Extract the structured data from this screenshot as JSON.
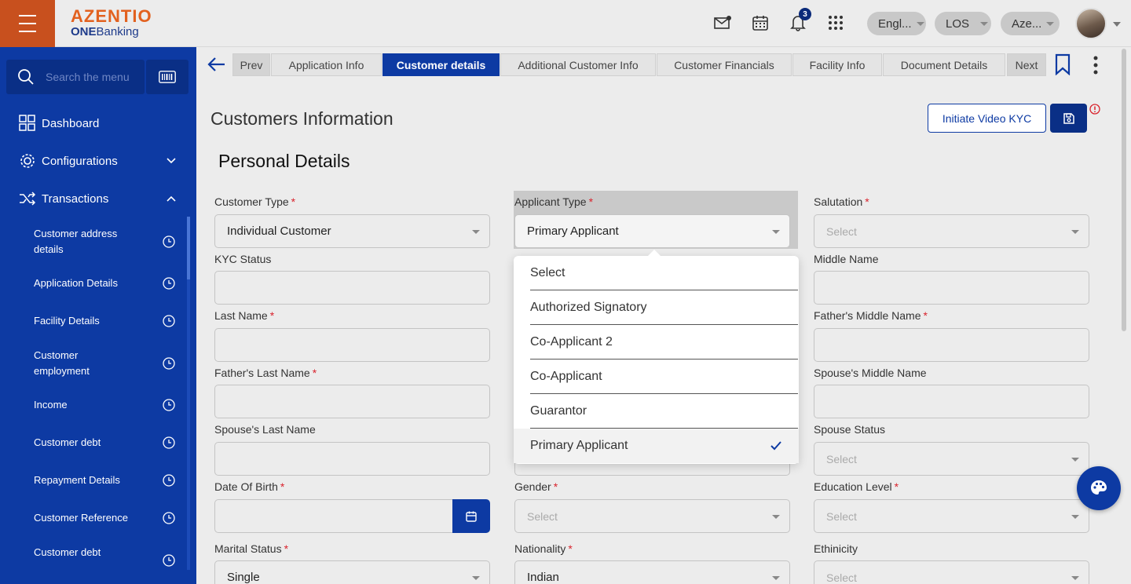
{
  "brand": {
    "name": "AZENTIO",
    "sub_bold": "ONE",
    "sub_rest": "Banking"
  },
  "header": {
    "notification_count": "3",
    "language": "Engl...",
    "module": "LOS",
    "entity": "Aze..."
  },
  "sidebar": {
    "search_placeholder": "Search the menu",
    "top_items": [
      {
        "label": "Dashboard",
        "icon": "dashboard-grid-icon"
      },
      {
        "label": "Configurations",
        "icon": "gear-icon"
      },
      {
        "label": "Transactions",
        "icon": "shuffle-icon"
      }
    ],
    "sub_items": [
      {
        "label": "Customer address details"
      },
      {
        "label": "Application Details"
      },
      {
        "label": "Facility Details"
      },
      {
        "label": "Customer employment"
      },
      {
        "label": "Income"
      },
      {
        "label": "Customer debt"
      },
      {
        "label": "Repayment Details"
      },
      {
        "label": "Customer Reference"
      },
      {
        "label": "Customer debt"
      }
    ]
  },
  "tabs": {
    "prev": "Prev",
    "next": "Next",
    "items": [
      {
        "label": "Application Info"
      },
      {
        "label": "Customer details",
        "active": true
      },
      {
        "label": "Additional Customer Info"
      },
      {
        "label": "Customer Financials"
      },
      {
        "label": "Facility Info"
      },
      {
        "label": "Document Details"
      }
    ]
  },
  "page": {
    "title": "Customers Information",
    "section": "Personal Details",
    "initiate_kyc": "Initiate Video KYC"
  },
  "form": {
    "customer_type": {
      "label": "Customer Type",
      "value": "Individual Customer"
    },
    "applicant_type": {
      "label": "Applicant Type",
      "value": "Primary Applicant"
    },
    "salutation": {
      "label": "Salutation",
      "value": "Select"
    },
    "kyc_status": {
      "label": "KYC Status",
      "value": ""
    },
    "middle_name": {
      "label": "Middle Name",
      "value": ""
    },
    "last_name": {
      "label": "Last Name",
      "value": ""
    },
    "fathers_middle_name": {
      "label": "Father's Middle Name",
      "value": ""
    },
    "fathers_last_name": {
      "label": "Father's Last Name",
      "value": ""
    },
    "spouses_middle_name": {
      "label": "Spouse's Middle Name",
      "value": ""
    },
    "spouses_last_name": {
      "label": "Spouse's Last Name",
      "value": ""
    },
    "spouse_status": {
      "label": "Spouse Status",
      "value": "Select"
    },
    "date_of_birth": {
      "label": "Date Of Birth",
      "value": ""
    },
    "gender": {
      "label": "Gender",
      "value": "Select"
    },
    "education_level": {
      "label": "Education Level",
      "value": "Select"
    },
    "marital_status": {
      "label": "Marital Status",
      "value": "Single"
    },
    "nationality": {
      "label": "Nationality",
      "value": "Indian"
    },
    "ethnicity": {
      "label": "Ethinicity",
      "value": "Select"
    }
  },
  "applicant_dropdown": {
    "options": [
      "Select",
      "Authorized Signatory",
      "Co-Applicant 2",
      "Co-Applicant",
      "Guarantor",
      "Primary Applicant"
    ],
    "selected": "Primary Applicant"
  },
  "colors": {
    "primary": "#0d3aa3",
    "brand_orange": "#c8501e",
    "required": "#d9232d"
  }
}
